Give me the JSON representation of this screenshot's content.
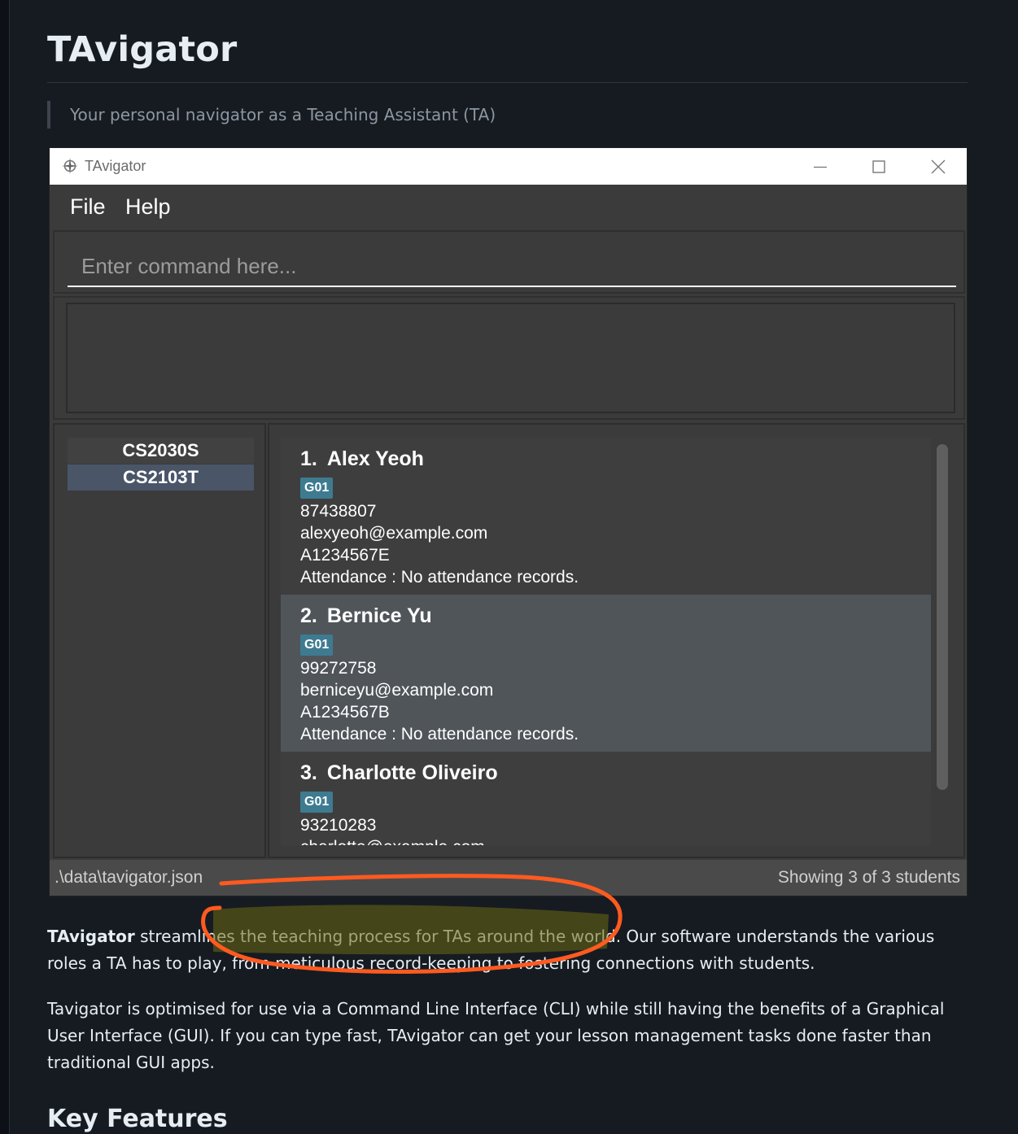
{
  "doc": {
    "title": "TAvigator",
    "quote": "Your personal navigator as a Teaching Assistant (TA)",
    "para1_bold": "TAvigator",
    "para1_rest": " streamlines the teaching process for TAs around the world. Our software understands the various roles a TA has to play, from meticulous record-keeping to fostering connections with students.",
    "para2": "Tavigator is optimised for use via a Command Line Interface (CLI) while still having the benefits of a Graphical User Interface (GUI). If you can type fast, TAvigator can get your lesson management tasks done faster than traditional GUI apps.",
    "section_heading": "Key Features"
  },
  "app": {
    "window_title": "TAvigator",
    "menu": {
      "file": "File",
      "help": "Help"
    },
    "command_placeholder": "Enter command here...",
    "courses": [
      {
        "label": "CS2030S",
        "selected": false
      },
      {
        "label": "CS2103T",
        "selected": true
      }
    ],
    "students": [
      {
        "index": "1.",
        "name": "Alex Yeoh",
        "tag": "G01",
        "phone": "87438807",
        "email": "alexyeoh@example.com",
        "student_id": "A1234567E",
        "attendance": "Attendance : No attendance records."
      },
      {
        "index": "2.",
        "name": "Bernice Yu",
        "tag": "G01",
        "phone": "99272758",
        "email": "berniceyu@example.com",
        "student_id": "A1234567B",
        "attendance": "Attendance : No attendance records."
      },
      {
        "index": "3.",
        "name": "Charlotte Oliveiro",
        "tag": "G01",
        "phone": "93210283",
        "email": "charlotte@example.com"
      }
    ],
    "status_left": ".\\data\\tavigator.json",
    "status_right": "Showing 3 of 3 students"
  },
  "colors": {
    "page_bg": "#161b22",
    "app_bg": "#3b3b3b",
    "selected_card": "#50555a",
    "selected_course": "#4a5568",
    "tag": "#3e7b91",
    "annotation_stroke": "#ff5a1f",
    "highlight": "#f4f26a"
  }
}
